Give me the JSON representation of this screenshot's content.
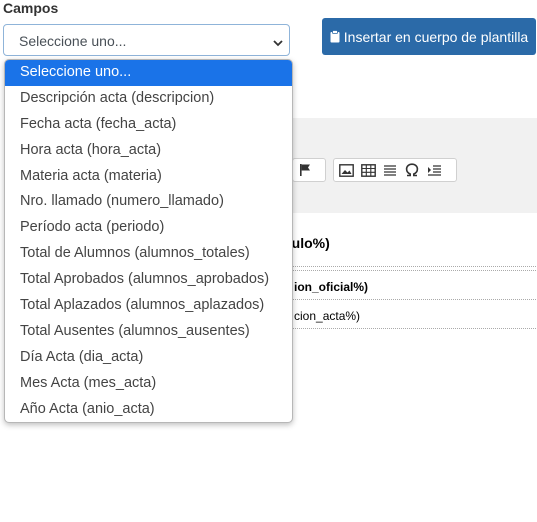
{
  "campos_label": "Campos",
  "select": {
    "value": "Seleccione uno...",
    "chevron_icon": "chevron-down-icon"
  },
  "insert_button": {
    "label": "Insertar en cuerpo de plantilla",
    "icon": "clipboard-icon"
  },
  "toolbar": {
    "icons": [
      "flag-icon",
      "image-icon",
      "table-icon",
      "horizontal-rule-icon",
      "omega-icon",
      "indent-icon"
    ]
  },
  "document": {
    "heading_fragment": "tulo%)",
    "line1": "ion_oficial%)",
    "line2": "cion_acta%)"
  },
  "dropdown": {
    "options": [
      "Seleccione uno...",
      "Descripción acta (descripcion)",
      "Fecha acta (fecha_acta)",
      "Hora acta (hora_acta)",
      "Materia acta (materia)",
      "Nro. llamado (numero_llamado)",
      "Período acta (periodo)",
      "Total de Alumnos (alumnos_totales)",
      "Total Aprobados (alumnos_aprobados)",
      "Total Aplazados (alumnos_aplazados)",
      "Total Ausentes (alumnos_ausentes)",
      "Día Acta (dia_acta)",
      "Mes Acta (mes_acta)",
      "Año Acta (anio_acta)"
    ],
    "selected_index": 0
  },
  "colors": {
    "button_bg": "#2b6aa8",
    "selected_bg": "#1a73e8"
  }
}
